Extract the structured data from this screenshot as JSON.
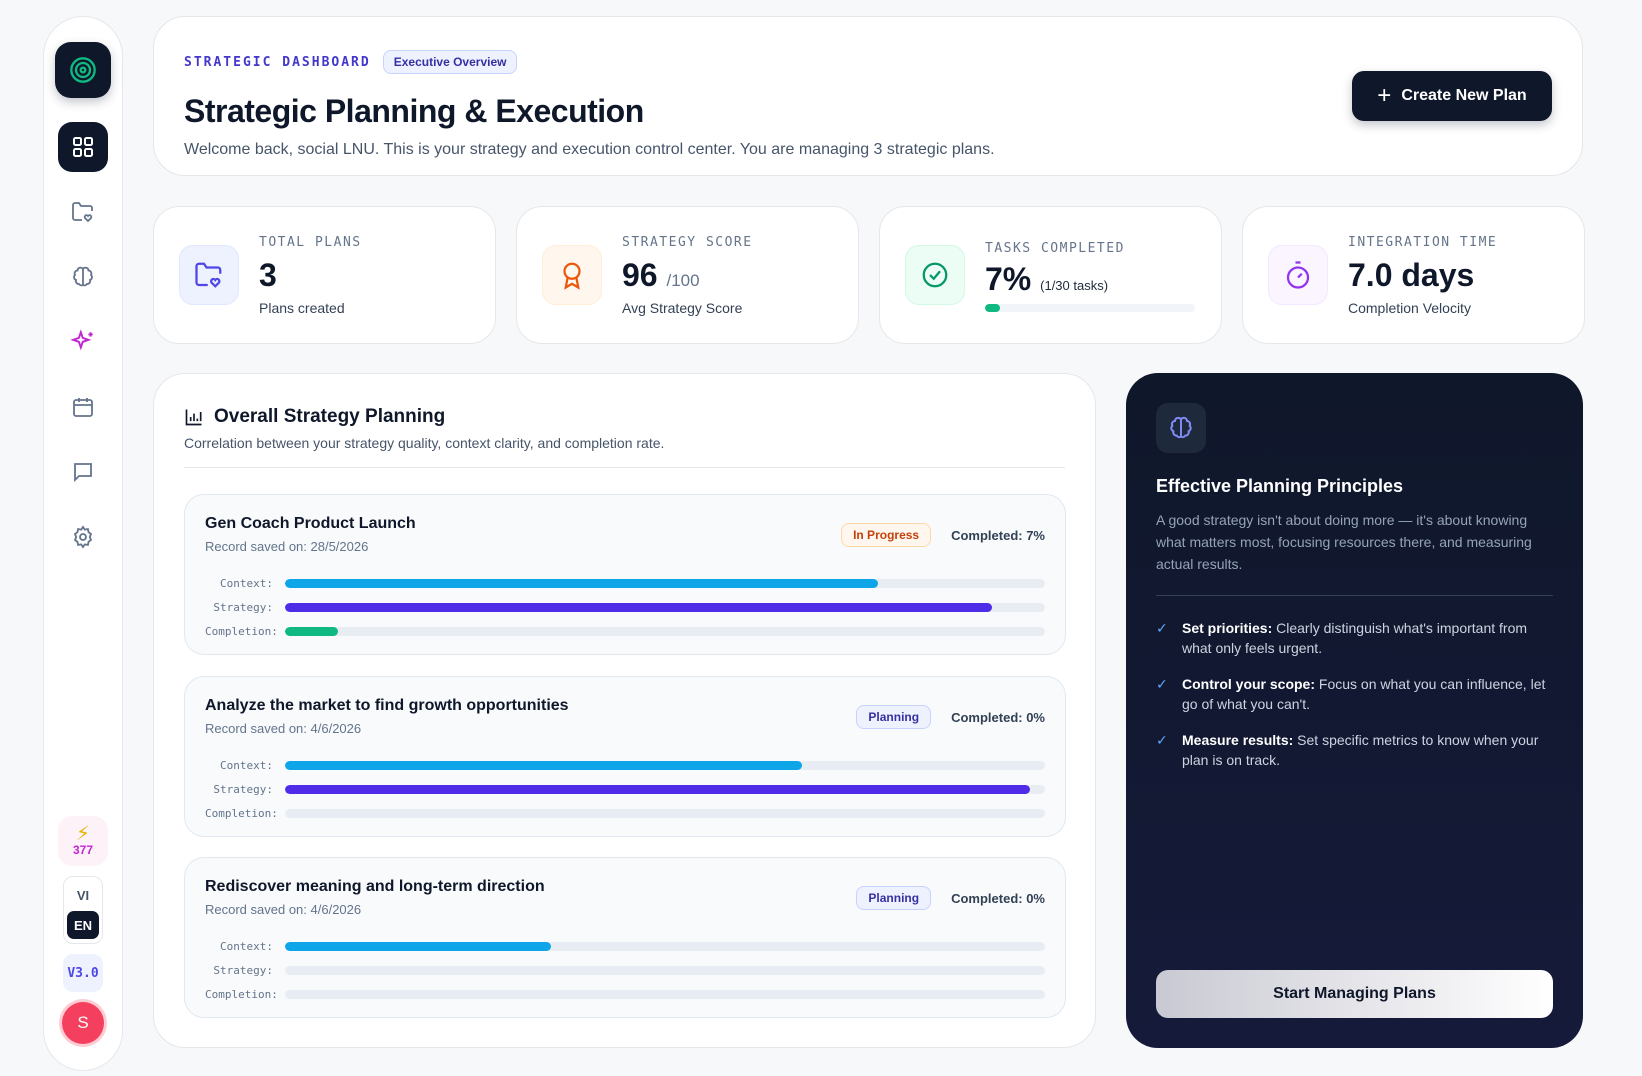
{
  "sidebar": {
    "energy": "377",
    "lang_on": "EN",
    "lang_off": "VI",
    "version": "V3.0",
    "avatar": "S",
    "nav_icons": [
      "dashboard-icon",
      "folder-heart-icon",
      "brain-icon",
      "sparkles-icon",
      "calendar-icon",
      "chat-icon",
      "gear-icon"
    ]
  },
  "header": {
    "eyebrow": "STRATEGIC DASHBOARD",
    "pill": "Executive Overview",
    "title": "Strategic Planning & Execution",
    "subtitle": "Welcome back, social LNU. This is your strategy and execution control center. You are managing 3 strategic plans.",
    "create_label": "Create New Plan"
  },
  "stats": [
    {
      "label": "TOTAL PLANS",
      "value": "3",
      "sub": "Plans created",
      "icon": "folder-heart-icon",
      "color": "#4f46e5"
    },
    {
      "label": "STRATEGY SCORE",
      "value": "96",
      "suffix": "/100",
      "sub": "Avg Strategy Score",
      "icon": "award-icon",
      "color": "#ea580c"
    },
    {
      "label": "TASKS COMPLETED",
      "value": "7%",
      "suffix": "(1/30 tasks)",
      "progress": 0.07,
      "icon": "check-circle-icon",
      "color": "#059669"
    },
    {
      "label": "INTEGRATION TIME",
      "value": "7.0 days",
      "sub": "Completion Velocity",
      "icon": "timer-icon",
      "color": "#9333ea"
    }
  ],
  "overview": {
    "title": "Overall Strategy Planning",
    "subtitle": "Correlation between your strategy quality, context clarity, and completion rate.",
    "bar_labels": {
      "context": "Context:",
      "strategy": "Strategy:",
      "completion": "Completion:"
    },
    "plans": [
      {
        "name": "Gen Coach Product Launch",
        "date": "Record saved on: 28/5/2026",
        "status": "In Progress",
        "status_type": "progress",
        "completed": "Completed: 7%",
        "context": 0.78,
        "strategy": 0.93,
        "completion": 0.07
      },
      {
        "name": "Analyze the market to find growth opportunities",
        "date": "Record saved on: 4/6/2026",
        "status": "Planning",
        "status_type": "planning",
        "completed": "Completed: 0%",
        "context": 0.68,
        "strategy": 0.98,
        "completion": 0
      },
      {
        "name": "Rediscover meaning and long-term direction",
        "date": "Record saved on: 4/6/2026",
        "status": "Planning",
        "status_type": "planning",
        "completed": "Completed: 0%",
        "context": 0.35,
        "strategy": 0,
        "completion": 0
      }
    ]
  },
  "principles": {
    "title": "Effective Planning Principles",
    "desc": "A good strategy isn't about doing more — it's about knowing what matters most, focusing resources there, and measuring actual results.",
    "items": [
      {
        "bold": "Set priorities:",
        "text": "Clearly distinguish what's important from what only feels urgent."
      },
      {
        "bold": "Control your scope:",
        "text": "Focus on what you can influence, let go of what you can't."
      },
      {
        "bold": "Measure results:",
        "text": "Set specific metrics to know when your plan is on track."
      }
    ],
    "cta": "Start Managing Plans"
  }
}
